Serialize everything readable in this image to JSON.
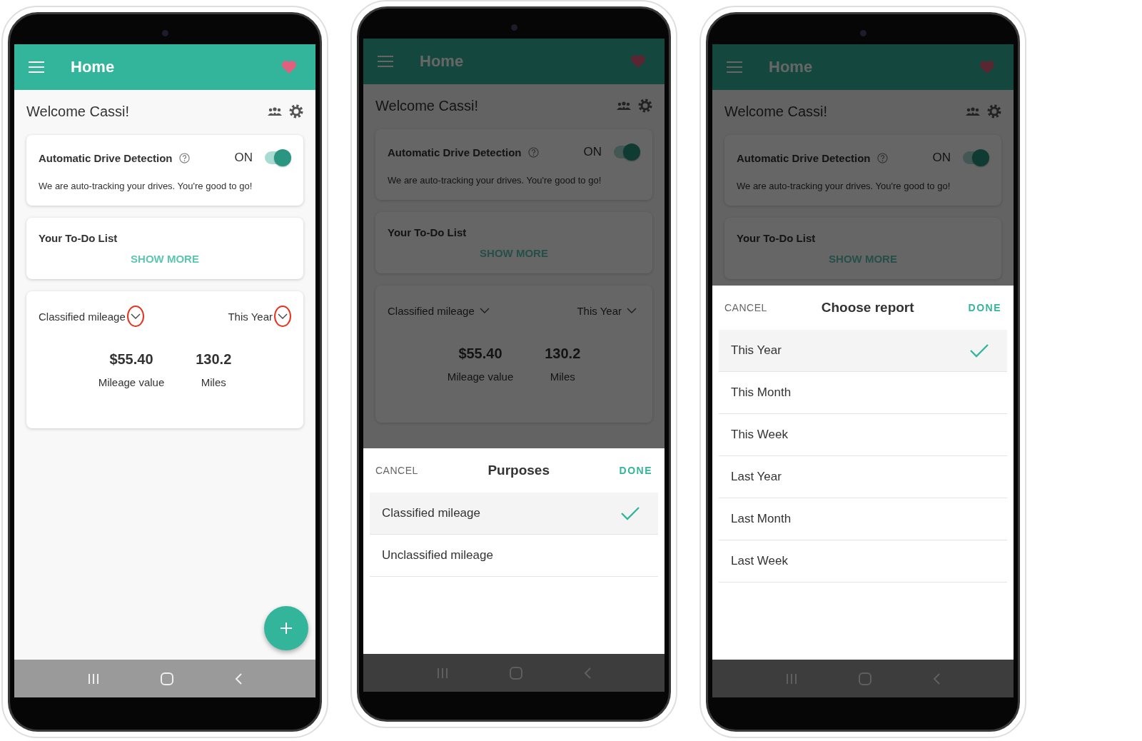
{
  "phones": [
    {
      "app_bar": {
        "title": "Home"
      },
      "welcome": "Welcome Cassi!",
      "drive_card": {
        "title": "Automatic Drive Detection",
        "status": "ON",
        "on": true,
        "message": "We are auto-tracking your drives. You're good to go!"
      },
      "todo_card": {
        "title": "Your To-Do List",
        "action": "SHOW MORE"
      },
      "mileage_card": {
        "purpose": {
          "label": "Classified mileage",
          "highlighted": true
        },
        "period": {
          "label": "This Year",
          "highlighted": true
        },
        "stats": [
          {
            "value": "$55.40",
            "label": "Mileage value"
          },
          {
            "value": "130.2",
            "label": "Miles"
          }
        ]
      }
    },
    {
      "app_bar": {
        "title": "Home"
      },
      "welcome": "Welcome Cassi!",
      "drive_card": {
        "title": "Automatic Drive Detection",
        "status": "ON",
        "on": true,
        "message": "We are auto-tracking your drives. You're good to go!"
      },
      "todo_card": {
        "title": "Your To-Do List",
        "action": "SHOW MORE"
      },
      "mileage_card": {
        "purpose": {
          "label": "Classified mileage",
          "highlighted": false
        },
        "period": {
          "label": "This Year",
          "highlighted": false
        },
        "stats": [
          {
            "value": "$55.40",
            "label": "Mileage value"
          },
          {
            "value": "130.2",
            "label": "Miles"
          }
        ]
      },
      "sheet": {
        "cancel": "CANCEL",
        "title": "Purposes",
        "done": "DONE",
        "options": [
          {
            "label": "Classified mileage",
            "selected": true
          },
          {
            "label": "Unclassified mileage",
            "selected": false
          }
        ]
      }
    },
    {
      "app_bar": {
        "title": "Home"
      },
      "welcome": "Welcome Cassi!",
      "drive_card": {
        "title": "Automatic Drive Detection",
        "status": "ON",
        "on": true,
        "message": "We are auto-tracking your drives. You're good to go!"
      },
      "todo_card": {
        "title": "Your To-Do List",
        "action": "SHOW MORE"
      },
      "sheet": {
        "cancel": "CANCEL",
        "title": "Choose report",
        "done": "DONE",
        "options": [
          {
            "label": "This Year",
            "selected": true
          },
          {
            "label": "This Month",
            "selected": false
          },
          {
            "label": "This Week",
            "selected": false
          },
          {
            "label": "Last Year",
            "selected": false
          },
          {
            "label": "Last Month",
            "selected": false
          },
          {
            "label": "Last Week",
            "selected": false
          }
        ]
      }
    }
  ]
}
